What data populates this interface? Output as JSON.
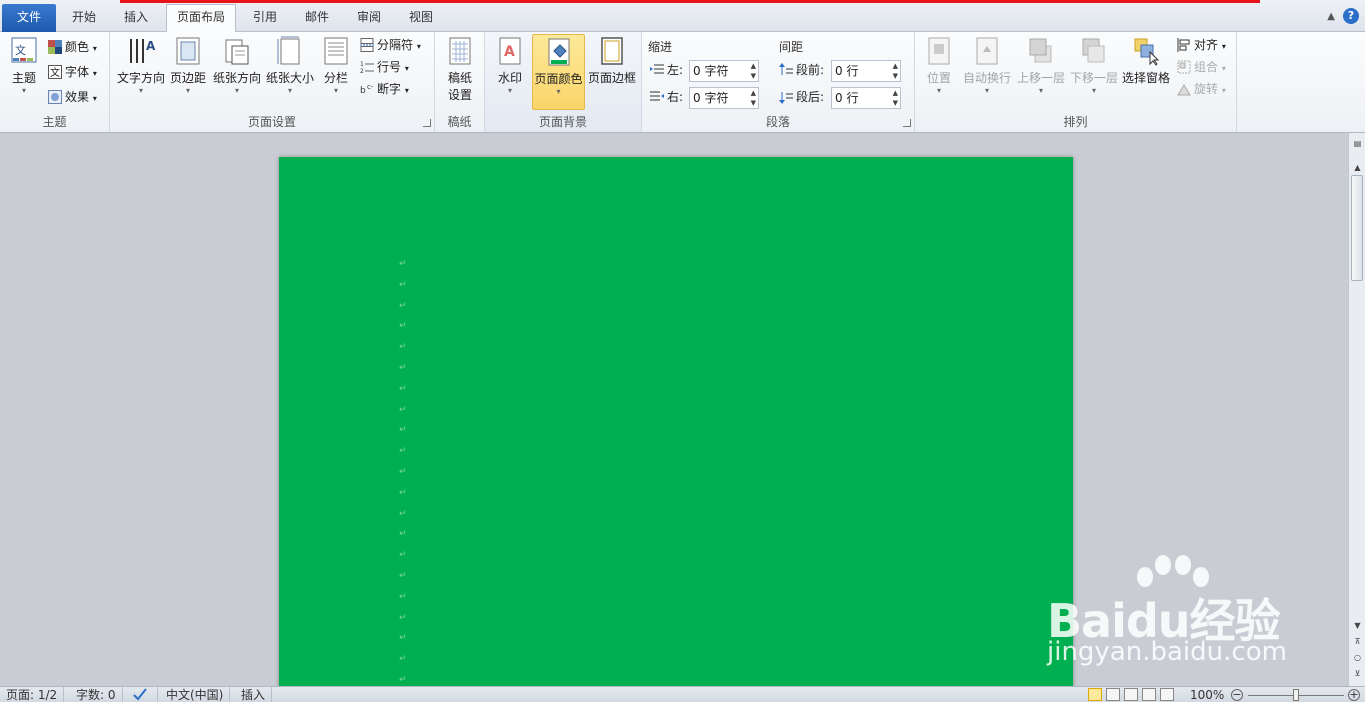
{
  "tabs": {
    "file": "文件",
    "home": "开始",
    "insert": "插入",
    "layout": "页面布局",
    "references": "引用",
    "mailings": "邮件",
    "review": "审阅",
    "view": "视图"
  },
  "ribbon": {
    "theme_group": {
      "label": "主题",
      "themes": "主题",
      "colors": "颜色",
      "fonts": "字体",
      "effects": "效果"
    },
    "page_setup": {
      "label": "页面设置",
      "text_direction": "文字方向",
      "margins": "页边距",
      "orientation": "纸张方向",
      "size": "纸张大小",
      "columns": "分栏",
      "breaks": "分隔符",
      "line_numbers": "行号",
      "hyphenation": "断字"
    },
    "manuscript": {
      "label": "稿纸",
      "settings_line1": "稿纸",
      "settings_line2": "设置"
    },
    "page_background": {
      "label": "页面背景",
      "watermark": "水印",
      "page_color": "页面颜色",
      "page_borders": "页面边框"
    },
    "paragraph": {
      "label": "段落",
      "indent_title": "缩进",
      "spacing_title": "间距",
      "left_label": "左:",
      "left_value": "0 字符",
      "right_label": "右:",
      "right_value": "0 字符",
      "before_label": "段前:",
      "before_value": "0 行",
      "after_label": "段后:",
      "after_value": "0 行"
    },
    "arrange": {
      "label": "排列",
      "position": "位置",
      "wrap_text": "自动换行",
      "bring_forward": "上移一层",
      "send_backward": "下移一层",
      "selection_pane": "选择窗格",
      "align": "对齐",
      "group": "组合",
      "rotate": "旋转"
    }
  },
  "document": {
    "page_color": "#00b050",
    "para_mark": "↵"
  },
  "statusbar": {
    "page": "页面: 1/2",
    "words": "字数: 0",
    "language": "中文(中国)",
    "mode": "插入",
    "zoom": "100%"
  },
  "watermark": {
    "brand": "Baidu经验",
    "url": "jingyan.baidu.com"
  },
  "colors": {
    "accent": "#2c6fc9",
    "highlight": "#fbd56a",
    "top_line": "#e8141a"
  }
}
